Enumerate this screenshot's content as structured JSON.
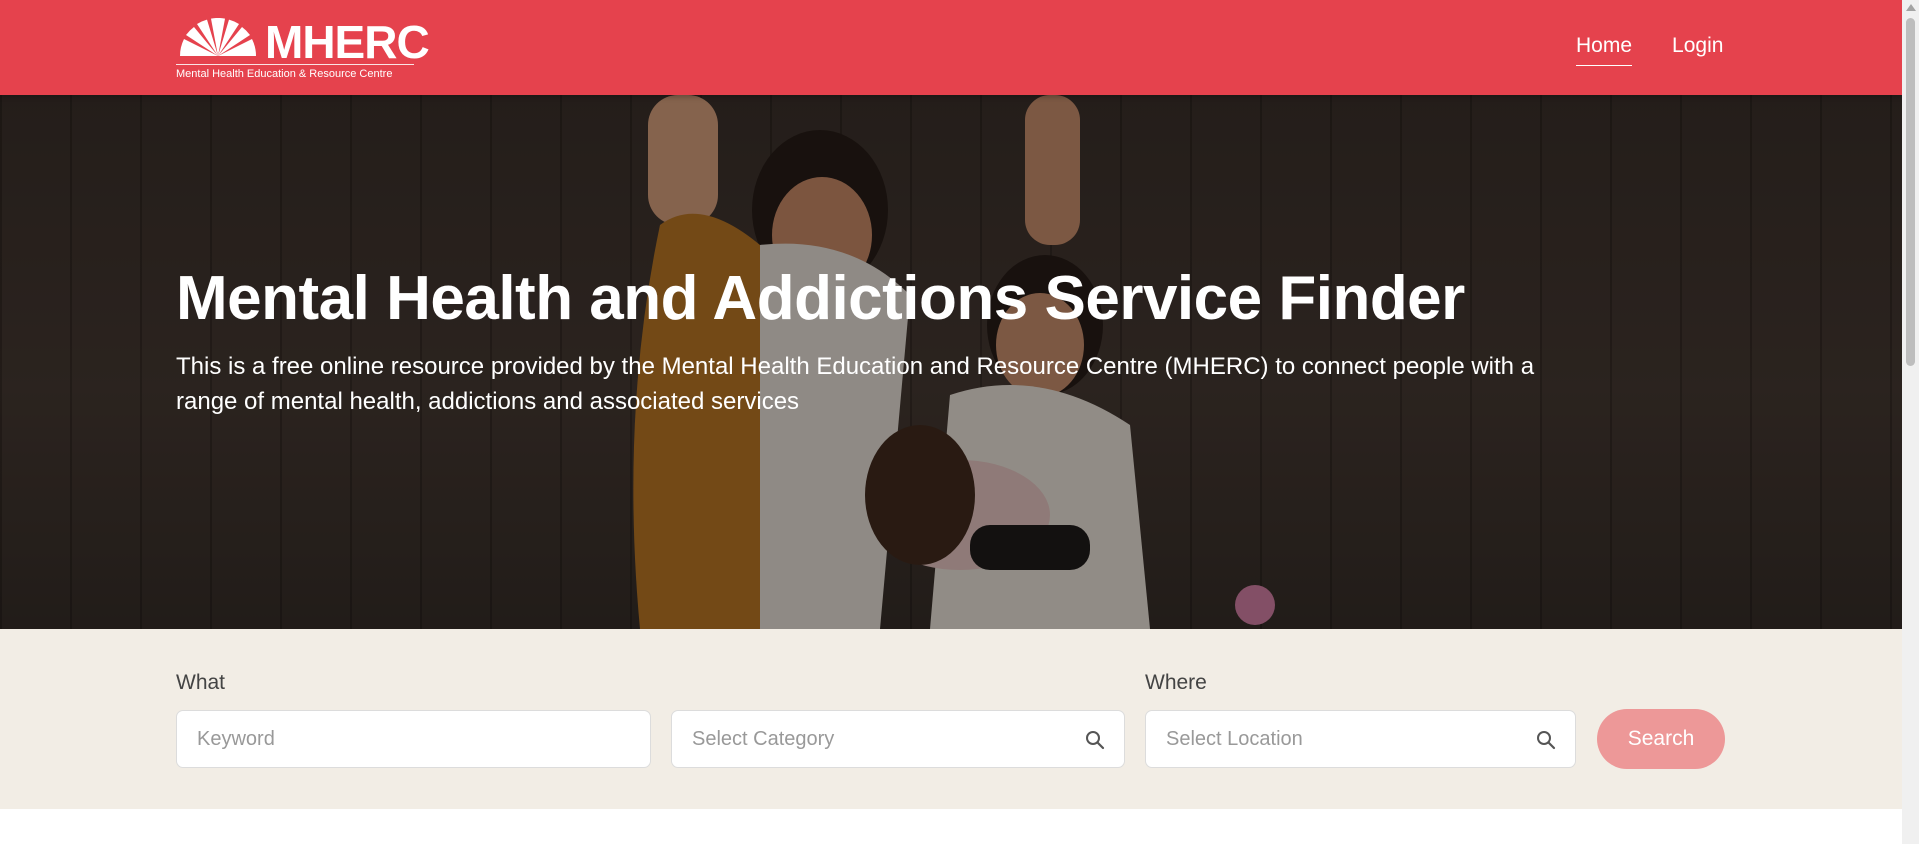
{
  "header": {
    "logo_name": "MHERC",
    "logo_tagline": "Mental Health Education & Resource Centre",
    "nav": [
      {
        "label": "Home",
        "active": true
      },
      {
        "label": "Login",
        "active": false
      }
    ]
  },
  "hero": {
    "title": "Mental Health and Addictions Service Finder",
    "description": "This is a free online resource provided by the Mental Health Education and Resource Centre (MHERC) to connect people with a range of mental health, addictions and associated services"
  },
  "search": {
    "what_label": "What",
    "where_label": "Where",
    "keyword_placeholder": "Keyword",
    "category_placeholder": "Select Category",
    "location_placeholder": "Select Location",
    "button_label": "Search"
  },
  "colors": {
    "brand": "#e5424d",
    "search_button": "#ed9898",
    "search_band": "#f2ede5"
  }
}
